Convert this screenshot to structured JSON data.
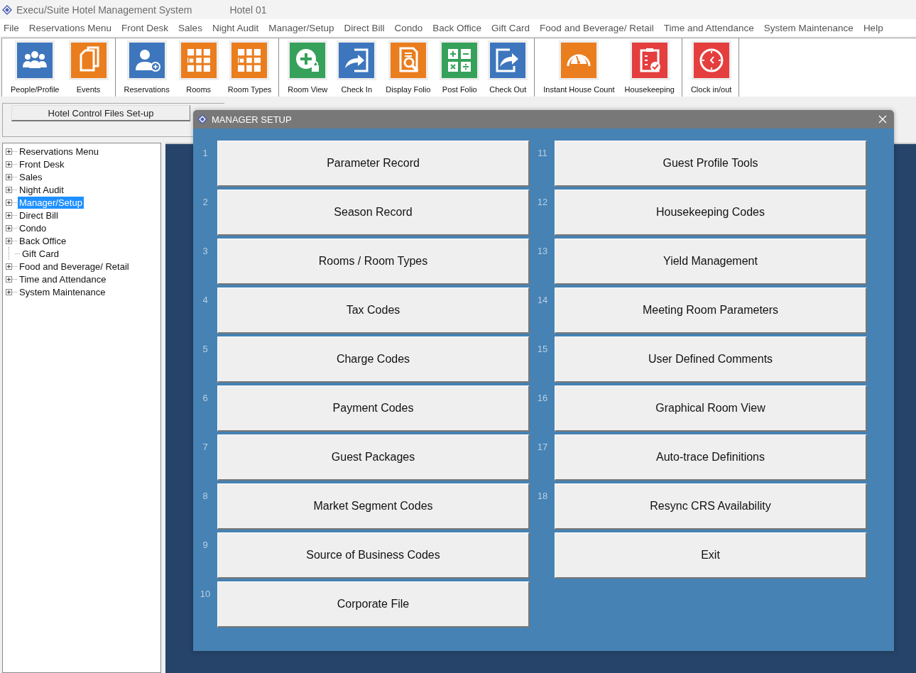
{
  "window": {
    "title": "Execu/Suite Hotel Management System",
    "subtitle": "Hotel 01"
  },
  "menu": [
    "File",
    "Reservations Menu",
    "Front Desk",
    "Sales",
    "Night Audit",
    "Manager/Setup",
    "Direct Bill",
    "Condo",
    "Back Office",
    "Gift Card",
    "Food and Beverage/ Retail",
    "Time and Attendance",
    "System Maintenance",
    "Help"
  ],
  "toolbar": [
    [
      {
        "label": "People/Profile",
        "kind": "people",
        "color": "#3d76bd"
      },
      {
        "label": "Events",
        "kind": "pages",
        "color": "#ea7d1e"
      }
    ],
    [
      {
        "label": "Reservations",
        "kind": "person-add",
        "color": "#3d76bd"
      },
      {
        "label": "Rooms",
        "kind": "grid",
        "color": "#ea7d1e"
      },
      {
        "label": "Room Types",
        "kind": "grid",
        "color": "#ea7d1e"
      }
    ],
    [
      {
        "label": "Room View",
        "kind": "plus-lock",
        "color": "#36a15a"
      },
      {
        "label": "Check In",
        "kind": "arrow-in",
        "color": "#3d76bd"
      },
      {
        "label": "Display Folio",
        "kind": "doc-search",
        "color": "#ea7d1e"
      },
      {
        "label": "Post Folio",
        "kind": "calc",
        "color": "#36a15a"
      },
      {
        "label": "Check Out",
        "kind": "arrow-out",
        "color": "#3d76bd"
      }
    ],
    [
      {
        "label": "Instant House Count",
        "kind": "gauge",
        "color": "#ea7d1e"
      },
      {
        "label": "Housekeeping",
        "kind": "clipboard",
        "color": "#e43e3e"
      }
    ],
    [
      {
        "label": "Clock in/out",
        "kind": "clock",
        "color": "#e43e3e"
      }
    ]
  ],
  "setup_button": "Hotel Control Files Set-up",
  "tree": [
    {
      "label": "Reservations Menu",
      "kind": "folder",
      "selected": false
    },
    {
      "label": "Front Desk",
      "kind": "folder",
      "selected": false
    },
    {
      "label": "Sales",
      "kind": "folder",
      "selected": false
    },
    {
      "label": "Night Audit",
      "kind": "folder",
      "selected": false
    },
    {
      "label": "Manager/Setup",
      "kind": "folder",
      "selected": true
    },
    {
      "label": "Direct Bill",
      "kind": "folder",
      "selected": false
    },
    {
      "label": "Condo",
      "kind": "folder",
      "selected": false
    },
    {
      "label": "Back Office",
      "kind": "folder",
      "selected": false
    },
    {
      "label": "Gift Card",
      "kind": "leaf",
      "selected": false
    },
    {
      "label": "Food and Beverage/ Retail",
      "kind": "folder",
      "selected": false
    },
    {
      "label": "Time and Attendance",
      "kind": "folder",
      "selected": false
    },
    {
      "label": "System Maintenance",
      "kind": "folder",
      "selected": false
    }
  ],
  "dialog": {
    "title": "MANAGER SETUP",
    "left": [
      {
        "number": "1",
        "label": "Parameter Record"
      },
      {
        "number": "2",
        "label": "Season Record"
      },
      {
        "number": "3",
        "label": "Rooms / Room Types"
      },
      {
        "number": "4",
        "label": "Tax Codes"
      },
      {
        "number": "5",
        "label": "Charge Codes"
      },
      {
        "number": "6",
        "label": "Payment Codes"
      },
      {
        "number": "7",
        "label": "Guest Packages"
      },
      {
        "number": "8",
        "label": "Market Segment Codes"
      },
      {
        "number": "9",
        "label": "Source of Business Codes"
      },
      {
        "number": "10",
        "label": "Corporate File"
      }
    ],
    "right": [
      {
        "number": "11",
        "label": "Guest Profile Tools"
      },
      {
        "number": "12",
        "label": "Housekeeping Codes"
      },
      {
        "number": "13",
        "label": "Yield Management"
      },
      {
        "number": "14",
        "label": "Meeting Room Parameters"
      },
      {
        "number": "15",
        "label": "User Defined Comments"
      },
      {
        "number": "16",
        "label": "Graphical Room View"
      },
      {
        "number": "17",
        "label": "Auto-trace Definitions"
      },
      {
        "number": "18",
        "label": "Resync CRS Availability"
      },
      {
        "label": "Exit"
      }
    ]
  }
}
